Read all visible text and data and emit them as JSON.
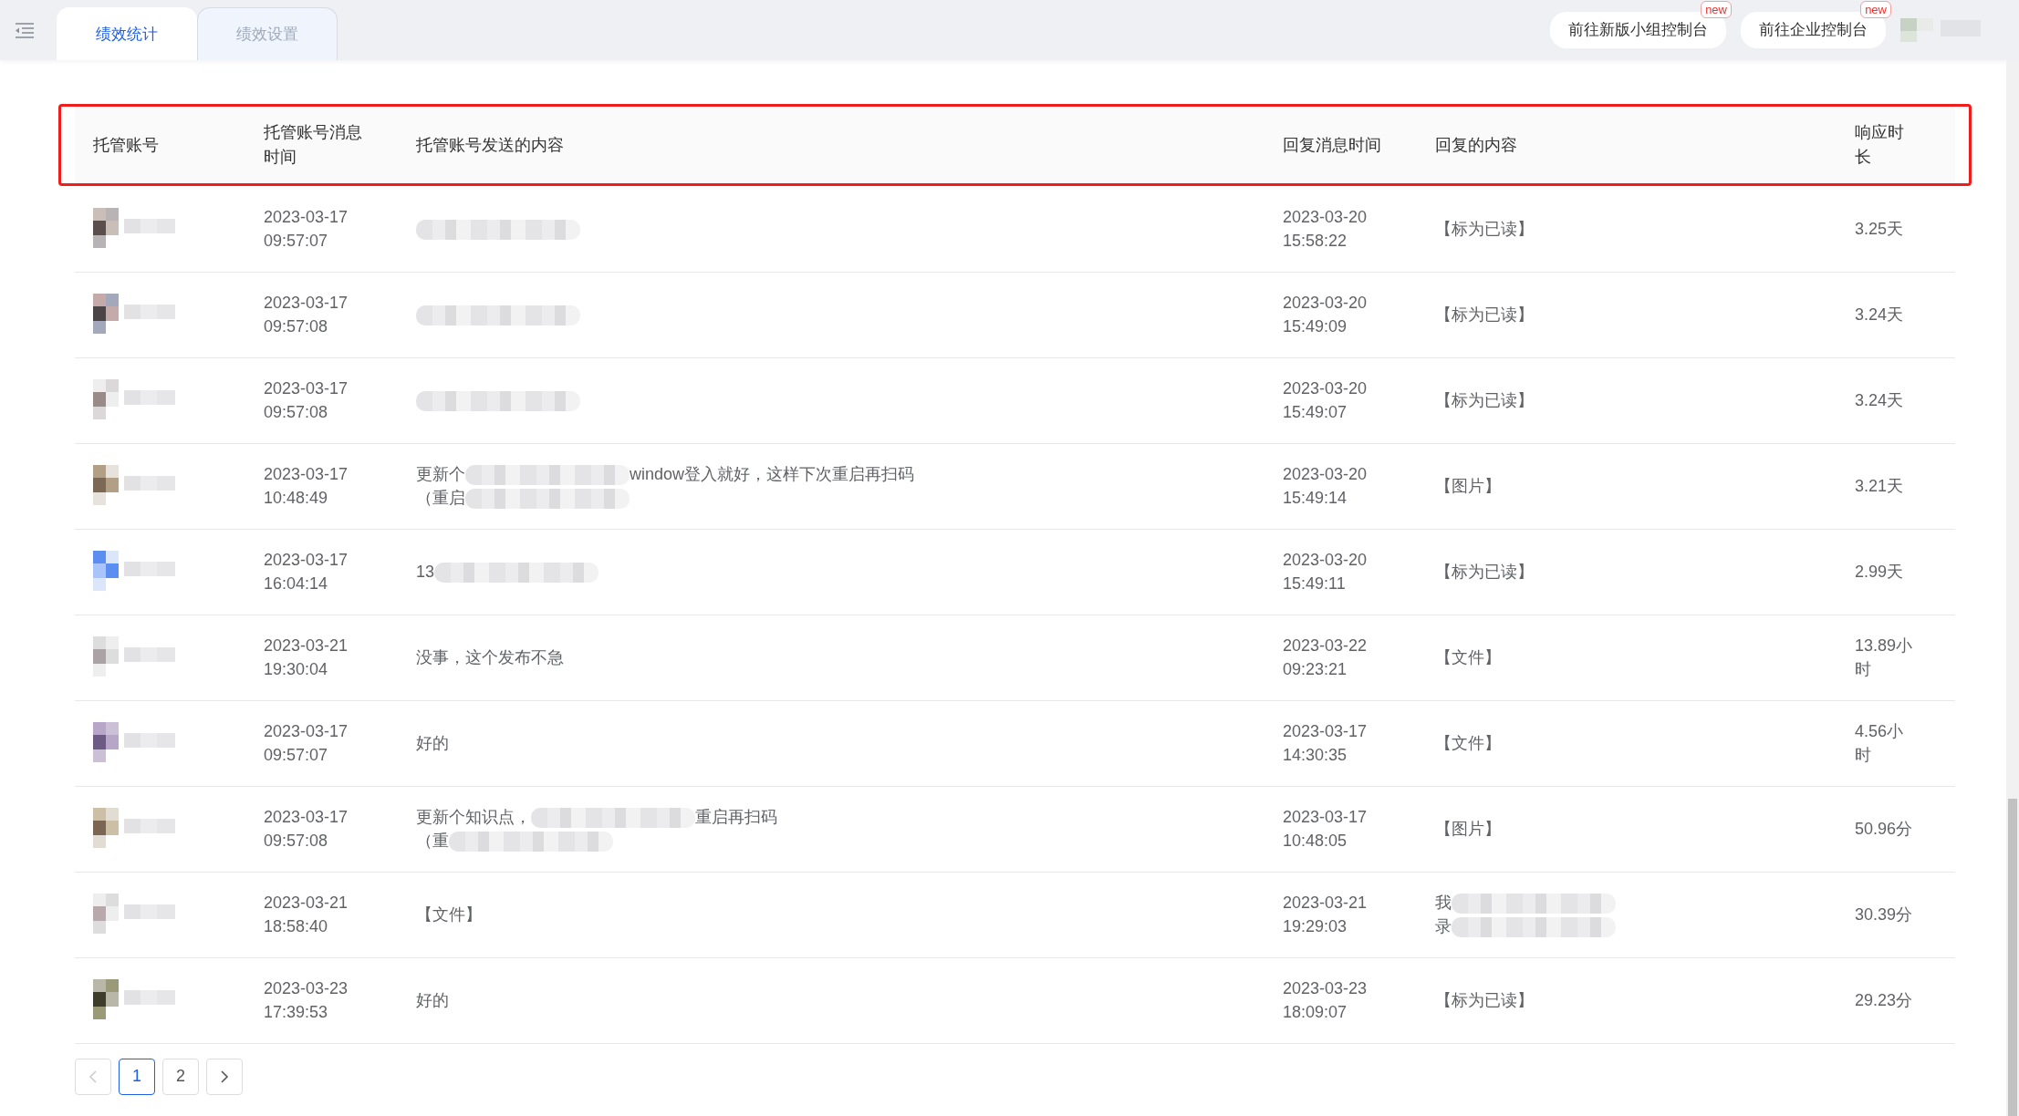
{
  "tabs": [
    {
      "label": "绩效统计",
      "selected": true
    },
    {
      "label": "绩效设置",
      "selected": false
    }
  ],
  "header_buttons": [
    {
      "label": "前往新版小组控制台",
      "badge": "new"
    },
    {
      "label": "前往企业控制台",
      "badge": "new"
    }
  ],
  "table": {
    "columns": [
      "托管账号",
      "托管账号消息时间",
      "托管账号发送的内容",
      "回复消息时间",
      "回复的内容",
      "响应时长"
    ],
    "rows": [
      {
        "sent_time": "2023-03-17 09:57:07",
        "content": [
          [
            {
              "kind": "blur"
            }
          ]
        ],
        "reply_time": "2023-03-20 15:58:22",
        "reply": [
          [
            {
              "kind": "text",
              "text": "【标为已读】"
            }
          ]
        ],
        "duration": "3.25天"
      },
      {
        "sent_time": "2023-03-17 09:57:08",
        "content": [
          [
            {
              "kind": "blur"
            }
          ]
        ],
        "reply_time": "2023-03-20 15:49:09",
        "reply": [
          [
            {
              "kind": "text",
              "text": "【标为已读】"
            }
          ]
        ],
        "duration": "3.24天"
      },
      {
        "sent_time": "2023-03-17 09:57:08",
        "content": [
          [
            {
              "kind": "blur"
            }
          ]
        ],
        "reply_time": "2023-03-20 15:49:07",
        "reply": [
          [
            {
              "kind": "text",
              "text": "【标为已读】"
            }
          ]
        ],
        "duration": "3.24天"
      },
      {
        "sent_time": "2023-03-17 10:48:49",
        "content": [
          [
            {
              "kind": "text",
              "text": "更新个"
            },
            {
              "kind": "blur"
            },
            {
              "kind": "text",
              "text": "window登入就好，这样下次重启再扫码"
            }
          ],
          [
            {
              "kind": "text",
              "text": "（重启"
            },
            {
              "kind": "blur"
            }
          ]
        ],
        "reply_time": "2023-03-20 15:49:14",
        "reply": [
          [
            {
              "kind": "text",
              "text": "【图片】"
            }
          ]
        ],
        "duration": "3.21天"
      },
      {
        "sent_time": "2023-03-17 16:04:14",
        "content": [
          [
            {
              "kind": "text",
              "text": "13"
            },
            {
              "kind": "blur"
            }
          ]
        ],
        "reply_time": "2023-03-20 15:49:11",
        "reply": [
          [
            {
              "kind": "text",
              "text": "【标为已读】"
            }
          ]
        ],
        "duration": "2.99天"
      },
      {
        "sent_time": "2023-03-21 19:30:04",
        "content": [
          [
            {
              "kind": "text",
              "text": "没事，这个发布不急"
            }
          ]
        ],
        "reply_time": "2023-03-22 09:23:21",
        "reply": [
          [
            {
              "kind": "text",
              "text": "【文件】"
            }
          ]
        ],
        "duration": "13.89小时"
      },
      {
        "sent_time": "2023-03-17 09:57:07",
        "content": [
          [
            {
              "kind": "text",
              "text": "好的"
            }
          ]
        ],
        "reply_time": "2023-03-17 14:30:35",
        "reply": [
          [
            {
              "kind": "text",
              "text": "【文件】"
            }
          ]
        ],
        "duration": "4.56小时"
      },
      {
        "sent_time": "2023-03-17 09:57:08",
        "content": [
          [
            {
              "kind": "text",
              "text": "更新个知识点，"
            },
            {
              "kind": "blur"
            },
            {
              "kind": "text",
              "text": "重启再扫码"
            }
          ],
          [
            {
              "kind": "text",
              "text": "（重"
            },
            {
              "kind": "blur"
            }
          ]
        ],
        "reply_time": "2023-03-17 10:48:05",
        "reply": [
          [
            {
              "kind": "text",
              "text": "【图片】"
            }
          ]
        ],
        "duration": "50.96分"
      },
      {
        "sent_time": "2023-03-21 18:58:40",
        "content": [
          [
            {
              "kind": "text",
              "text": "【文件】"
            }
          ]
        ],
        "reply_time": "2023-03-21 19:29:03",
        "reply": [
          [
            {
              "kind": "text",
              "text": "我"
            },
            {
              "kind": "blur"
            }
          ],
          [
            {
              "kind": "text",
              "text": "录"
            },
            {
              "kind": "blur"
            }
          ]
        ],
        "duration": "30.39分"
      },
      {
        "sent_time": "2023-03-23 17:39:53",
        "content": [
          [
            {
              "kind": "text",
              "text": "好的"
            }
          ]
        ],
        "reply_time": "2023-03-23 18:09:07",
        "reply": [
          [
            {
              "kind": "text",
              "text": "【标为已读】"
            }
          ]
        ],
        "duration": "29.23分"
      }
    ]
  },
  "pagination": {
    "pages": [
      {
        "label": "1",
        "selected": true
      },
      {
        "label": "2",
        "selected": false
      }
    ],
    "prev_disabled": true,
    "next_disabled": false
  }
}
